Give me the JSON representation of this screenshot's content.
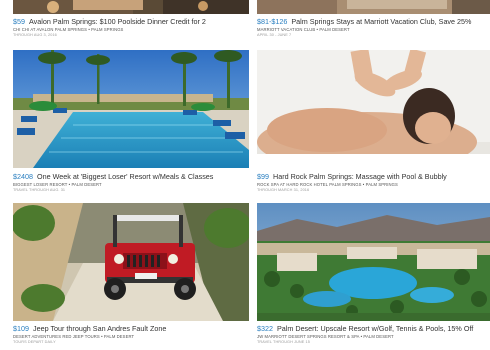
{
  "deals": [
    {
      "price": "$59",
      "title": "Avalon Palm Springs: $100 Poolside Dinner Credit for 2",
      "provider": "CHI CHI AT AVALON PALM SPRINGS • PALM SPRINGS",
      "note": "THROUGH AUG 3, 2016"
    },
    {
      "price": "$81-$126",
      "title": "Palm Springs Stays at Marriott Vacation Club, Save 25%",
      "provider": "MARRIOTT VACATION CLUB • PALM DESERT",
      "note": "APRIL 30 - JUNE 7"
    },
    {
      "price": "$2408",
      "title": "One Week at 'Biggest Loser' Resort w/Meals & Classes",
      "provider": "BIGGEST LOSER RESORT • PALM DESERT",
      "note": "TRAVEL THROUGH AUG. 31"
    },
    {
      "price": "$99",
      "title": "Hard Rock Palm Springs: Massage with Pool & Bubbly",
      "provider": "ROCK SPA AT HARD ROCK HOTEL PALM SPRINGS • PALM SPRINGS",
      "note": "THROUGH MARCH 31, 2016"
    },
    {
      "price": "$109",
      "title": "Jeep Tour through San Andres Fault Zone",
      "provider": "DESERT ADVENTURES RED JEEP TOURS • PALM DESERT",
      "note": "TOURS DEPART DAILY"
    },
    {
      "price": "$322",
      "title": "Palm Desert: Upscale Resort w/Golf, Tennis & Pools, 15% Off",
      "provider": "JW MARRIOTT DESERT SPRINGS RESORT & SPA • PALM DESERT",
      "note": "TRAVEL THROUGH JUNE 15"
    }
  ]
}
